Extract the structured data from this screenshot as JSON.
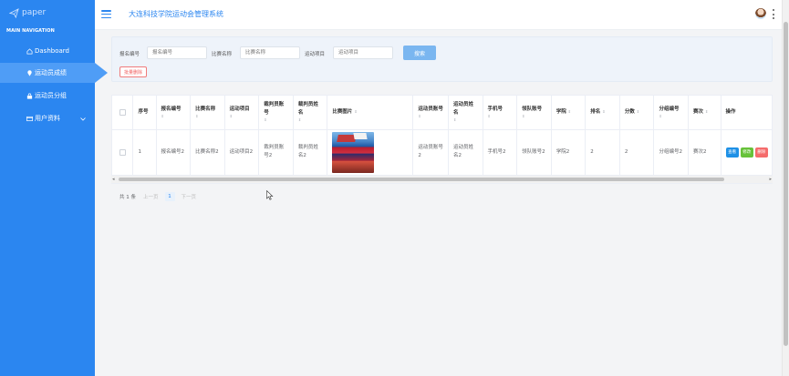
{
  "sidebar": {
    "logo_text": "paper",
    "nav_heading": "MAIN NAVIGATION",
    "items": [
      {
        "label": "Dashboard",
        "icon": "home-icon"
      },
      {
        "label": "运动员成绩",
        "icon": "pin-icon"
      },
      {
        "label": "运动员分组",
        "icon": "lock-icon"
      },
      {
        "label": "用户资料",
        "icon": "card-icon"
      }
    ]
  },
  "header": {
    "title": "大连科技学院运动会管理系统"
  },
  "search": {
    "fields": [
      {
        "label": "报名编号",
        "placeholder": "报名编号"
      },
      {
        "label": "比赛名称",
        "placeholder": "比赛名称"
      },
      {
        "label": "运动项目",
        "placeholder": "运动项目"
      }
    ],
    "search_button": "搜索",
    "batch_delete": "批量删除"
  },
  "table": {
    "columns": [
      "序号",
      "报名编号",
      "比赛名称",
      "运动项目",
      "裁判员账号",
      "裁判员姓名",
      "比赛图片",
      "运动员账号",
      "运动员姓名",
      "手机号",
      "领队账号",
      "学院",
      "排名",
      "分数",
      "分组编号",
      "赛次",
      "操作"
    ],
    "rows": [
      {
        "index": "1",
        "signup_no": "报名编号2",
        "match_name": "比赛名称2",
        "event": "运动项目2",
        "referee_account": "裁判员账号2",
        "referee_name": "裁判员姓名2",
        "athlete_account": "运动员账号2",
        "athlete_name": "运动员姓名2",
        "phone": "手机号2",
        "leader_account": "领队账号2",
        "college": "学院2",
        "rank": "2",
        "score": "2",
        "group_no": "分组编号2",
        "round": "赛次2",
        "actions": {
          "view": "查看",
          "edit": "修改",
          "delete": "删除"
        }
      }
    ]
  },
  "pagination": {
    "total": "共 1 条",
    "prev": "上一页",
    "current": "1",
    "next": "下一页"
  },
  "colors": {
    "sidebar": "#2b86f0",
    "active_item": "#4f9df6",
    "view_button": "#1e90e6",
    "edit_button": "#67c23a",
    "delete_button": "#f56c6c"
  }
}
